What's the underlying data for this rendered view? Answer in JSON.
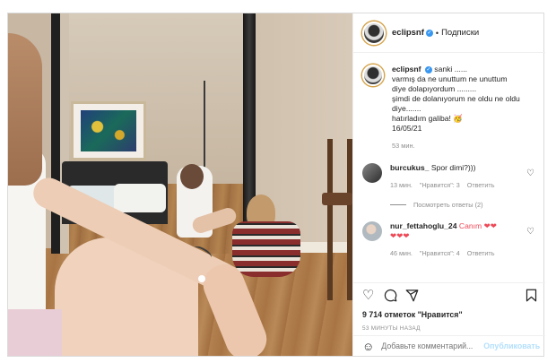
{
  "post": {
    "username": "eclipsnf",
    "follow_label": "Подписки",
    "caption_user": "eclipsnf",
    "caption_lines": [
      "sanki ......",
      "varmış da ne unuttum ne unuttum",
      "diye dolapıyordum .........",
      "şimdi de dolanıyorum ne oldu ne oldu",
      "diye.......",
      "hatırladım galiba! 🥳",
      "16/05/21"
    ],
    "caption_time": "53 мин."
  },
  "comments": [
    {
      "user": "burcukus_",
      "text": "Spor dimi?)))",
      "time": "13 мин.",
      "likes": "\"Нравится\": 3",
      "reply": "Ответить"
    },
    {
      "user": "nur_fettahoglu_24",
      "text": "Canım ❤❤",
      "hearts": "❤❤❤",
      "time": "46 мин.",
      "likes": "\"Нравится\": 4",
      "reply": "Ответить"
    }
  ],
  "view_replies": "Посмотреть ответы (2)",
  "actions": {
    "icons": [
      "heart-icon",
      "comment-icon",
      "share-icon",
      "bookmark-icon"
    ]
  },
  "likes_text": "9 714 отметок \"Нравится\"",
  "time_ago": "53 МИНУТЫ НАЗАД",
  "add_comment": {
    "placeholder": "Добавьте комментарий...",
    "publish_label": "Опубликовать"
  },
  "colors": {
    "link_blue": "#3897f0",
    "publish_disabled": "#b2dffc",
    "heart_red": "#ed4956"
  }
}
